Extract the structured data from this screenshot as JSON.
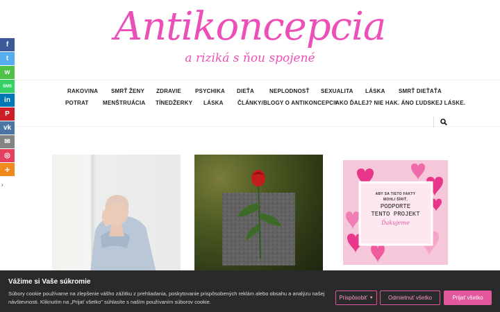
{
  "header": {
    "logo_title": "Antikoncepcia",
    "logo_subtitle": "a riziká s ňou spojené"
  },
  "nav": {
    "row1": [
      "RAKOVINA",
      "SMRŤ ŽENY",
      "ZDRAVIE",
      "PSYCHIKA",
      "DIEŤA",
      "NEPLODNOSŤ",
      "SEXUALITA",
      "LÁSKA",
      "SMRŤ DIEŤAŤA"
    ],
    "row2": [
      "POTRAT",
      "MENŠTRUÁCIA",
      "TÍNEDŽERKY",
      "LÁSKA",
      "ČLÁNKY/BLOGY O ANTIKONCEPCII",
      "AKO ĎALEJ? NIE HAK. ÁNO ĽUDSKEJ LÁSKE."
    ],
    "search_icon": "search-icon"
  },
  "share": {
    "items": [
      {
        "icon": "facebook-icon",
        "glyph": "f",
        "color": "#3b5998"
      },
      {
        "icon": "twitter-icon",
        "glyph": "t",
        "color": "#55acee"
      },
      {
        "icon": "whatsapp-icon",
        "glyph": "w",
        "color": "#4dc247"
      },
      {
        "icon": "sms-icon",
        "glyph": "SMS",
        "color": "#35d163"
      },
      {
        "icon": "linkedin-icon",
        "glyph": "in",
        "color": "#0077b5"
      },
      {
        "icon": "pinterest-icon",
        "glyph": "P",
        "color": "#cb2027"
      },
      {
        "icon": "vk-icon",
        "glyph": "vk",
        "color": "#4c75a3"
      },
      {
        "icon": "email-icon",
        "glyph": "✉",
        "color": "#848484"
      },
      {
        "icon": "instagram-icon",
        "glyph": "◎",
        "color": "#e4405f"
      },
      {
        "icon": "more-icon",
        "glyph": "+",
        "color": "#f18a1c"
      }
    ],
    "toggle_glyph": "›"
  },
  "promo": {
    "line1": "ABY SA TIETO FAKTY",
    "line2": "MOHLI ŠÍRIŤ,",
    "line3": "PODPORTE",
    "line4": "TENTO PROJEKT",
    "signature": "Ďakujeme"
  },
  "cookie": {
    "title": "Vážime si Vaše súkromie",
    "text": "Súbory cookie používame na zlepšenie vášho zážitku z prehliadania, poskytovanie prispôsobených reklám alebo obsahu a analýzu našej návštevnosti. Kliknutím na „Prijať všetko\" súhlasíte s naším používaním súborov cookie.",
    "customize": "Prispôsobiť",
    "reject": "Odmietnuť všetko",
    "accept": "Prijať všetko"
  },
  "colors": {
    "brand_pink": "#ec4fb8",
    "accept_button": "#e2589c",
    "cookie_bg": "#2a2a2a"
  }
}
